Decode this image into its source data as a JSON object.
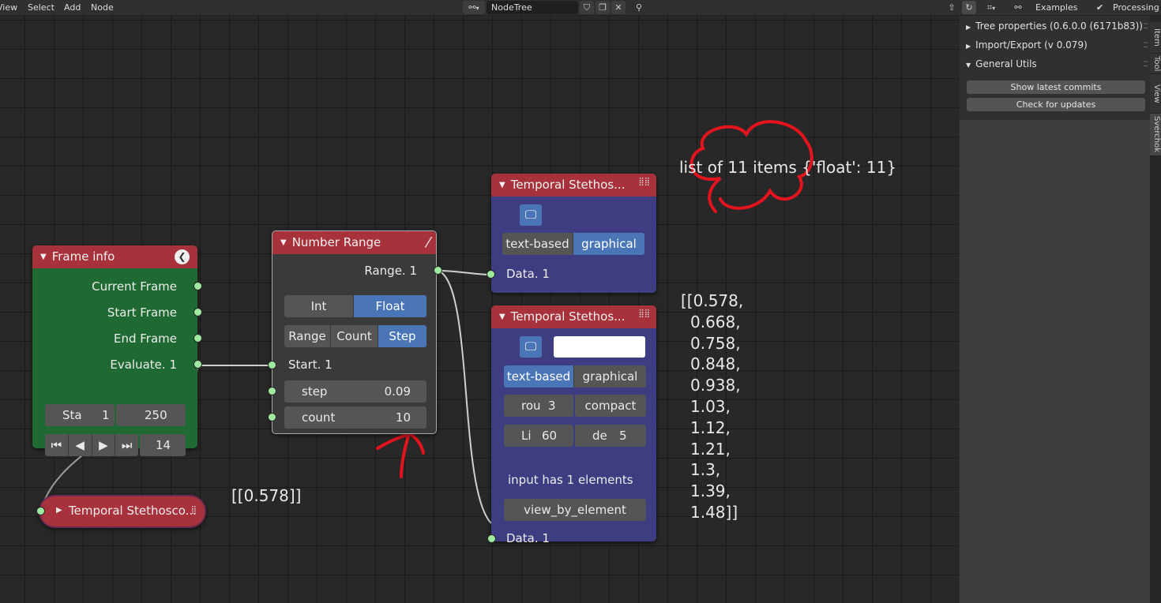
{
  "menu": [
    "View",
    "Select",
    "Add",
    "Node"
  ],
  "header": {
    "tree_name": "NodeTree",
    "examples_label": "Examples",
    "processing_label": "Processing",
    "processing_check": "✔"
  },
  "nodes": {
    "frame_info": {
      "title": "Frame info",
      "outputs": [
        "Current Frame",
        "Start Frame",
        "End Frame",
        "Evaluate. 1"
      ],
      "range_start_label": "Sta",
      "range_start_value": "1",
      "range_end_value": "250",
      "current_frame": "14",
      "color": "#1e6a32",
      "header_color": "#a8323c"
    },
    "number_range": {
      "title": "Number Range",
      "output": "Range. 1",
      "type_options": [
        "Int",
        "Float"
      ],
      "type_selected": "Float",
      "mode_options": [
        "Range",
        "Count",
        "Step"
      ],
      "mode_selected": "Step",
      "start_label": "Start. 1",
      "step_label": "step",
      "step_value": "0.09",
      "count_label": "count",
      "count_value": "10"
    },
    "stetho_top": {
      "title": "Temporal Stethos...",
      "modes": [
        "text-based",
        "graphical"
      ],
      "mode_selected": "graphical",
      "input_label": "Data. 1"
    },
    "stetho_bottom": {
      "title": "Temporal Stethos...",
      "modes": [
        "text-based",
        "graphical"
      ],
      "mode_selected": "text-based",
      "round_label": "rou",
      "round_value": "3",
      "compact_label": "compact",
      "line_label": "Li",
      "line_value": "60",
      "depth_label": "de",
      "depth_value": "5",
      "elements_text": "input has 1 elements",
      "view_button": "view_by_element",
      "input_label": "Data. 1"
    },
    "stetho_collapsed": {
      "title": "Temporal Stethosco..."
    }
  },
  "overlays": {
    "list_summary": "list of 11 items {'float': 11}",
    "single_value": "[[0.578]]",
    "values_lines": [
      "[[0.578,",
      "0.668,",
      "0.758,",
      "0.848,",
      "0.938,",
      "1.03,",
      "1.12,",
      "1.21,",
      "1.3,",
      "1.39,",
      "1.48]]"
    ]
  },
  "panel": {
    "rows": [
      {
        "label": "Tree properties (0.6.0.0 (6171b83))",
        "expanded": false
      },
      {
        "label": "Import/Export  (v 0.079)",
        "expanded": false
      },
      {
        "label": "General Utils",
        "expanded": true
      }
    ],
    "buttons": [
      "Show latest commits",
      "Check for updates"
    ],
    "tabs": [
      "Item",
      "Tool",
      "View",
      "Sverchok"
    ]
  },
  "colors": {
    "annotation_red": "#e3141e",
    "socket_green": "#9eea9e",
    "node_header": "#a8323c",
    "stetho_body": "#3f3d82",
    "frame_body": "#1e6a32",
    "toggle_blue": "#4a76b8"
  }
}
